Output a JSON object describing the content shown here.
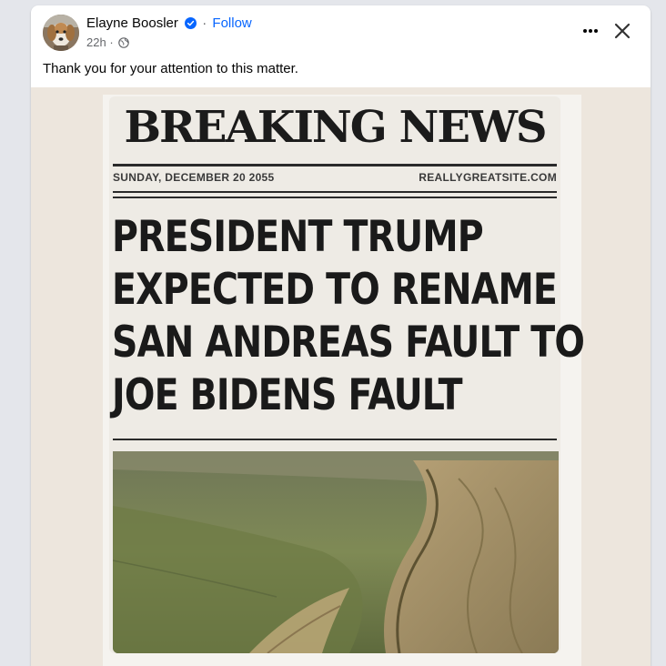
{
  "post": {
    "author": "Elayne Boosler",
    "separator": "·",
    "follow_label": "Follow",
    "timestamp": "22h",
    "meta_separator": "·",
    "audience_icon": "globe-icon",
    "verified_icon": "verified-badge-icon",
    "caption": "Thank you for your attention to this matter.",
    "more_icon": "more-options-icon",
    "close_icon": "close-icon"
  },
  "image": {
    "masthead": "BREAKING NEWS",
    "date": "SUNDAY, DECEMBER 20 2055",
    "site": "REALLYGREATSITE.COM",
    "headline_lines": [
      "PRESIDENT TRUMP",
      "EXPECTED TO RENAME",
      "SAN ANDREAS FAULT TO",
      "JOE BIDENS FAULT"
    ],
    "photo": "aerial-fault-landscape"
  },
  "colors": {
    "accent": "#0866ff",
    "text": "#050505",
    "secondary": "#65676b",
    "media_bg": "#ede6dd"
  }
}
